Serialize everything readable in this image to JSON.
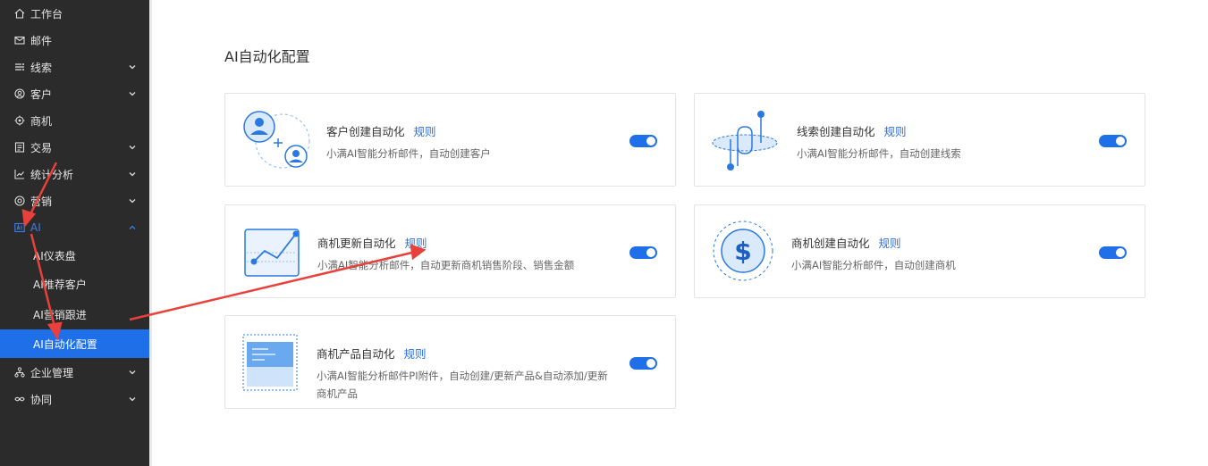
{
  "sidebar": {
    "items": [
      {
        "label": "工作台",
        "icon": "home-icon",
        "has_chevron": false
      },
      {
        "label": "邮件",
        "icon": "mail-icon",
        "has_chevron": false
      },
      {
        "label": "线索",
        "icon": "leads-icon",
        "has_chevron": true
      },
      {
        "label": "客户",
        "icon": "customer-icon",
        "has_chevron": true
      },
      {
        "label": "商机",
        "icon": "opportunity-icon",
        "has_chevron": false
      },
      {
        "label": "交易",
        "icon": "deal-icon",
        "has_chevron": true
      },
      {
        "label": "统计分析",
        "icon": "chart-icon",
        "has_chevron": true
      },
      {
        "label": "营销",
        "icon": "marketing-icon",
        "has_chevron": true
      },
      {
        "label": "AI",
        "icon": "ai-icon",
        "has_chevron": true,
        "expanded": true
      },
      {
        "label": "企业管理",
        "icon": "org-icon",
        "has_chevron": true
      },
      {
        "label": "协同",
        "icon": "collab-icon",
        "has_chevron": true
      }
    ],
    "ai_subitems": [
      {
        "label": "AI仪表盘"
      },
      {
        "label": "AI推荐客户"
      },
      {
        "label": "AI营销跟进"
      },
      {
        "label": "AI自动化配置",
        "active": true
      }
    ]
  },
  "main": {
    "title": "AI自动化配置",
    "cards": [
      {
        "title": "客户创建自动化",
        "rule": "规则",
        "desc": "小满AI智能分析邮件，自动创建客户",
        "enabled": true,
        "icon": "customer-create-illustration"
      },
      {
        "title": "线索创建自动化",
        "rule": "规则",
        "desc": "小满AI智能分析邮件，自动创建线索",
        "enabled": true,
        "icon": "lead-create-illustration"
      },
      {
        "title": "商机更新自动化",
        "rule": "规则",
        "desc": "小满AI智能分析邮件，自动更新商机销售阶段、销售金额",
        "enabled": true,
        "icon": "opportunity-update-illustration"
      },
      {
        "title": "商机创建自动化",
        "rule": "规则",
        "desc": "小满AI智能分析邮件，自动创建商机",
        "enabled": true,
        "icon": "opportunity-create-illustration"
      },
      {
        "title": "商机产品自动化",
        "rule": "规则",
        "desc": "小满AI智能分析邮件PI附件，自动创建/更新产品&自动添加/更新",
        "desc2": "商机产品",
        "enabled": true,
        "icon": "opportunity-product-illustration"
      }
    ]
  },
  "colors": {
    "accent": "#1e6fe8",
    "sidebar_bg": "#2b2b2b",
    "annotation": "#e8403a"
  }
}
